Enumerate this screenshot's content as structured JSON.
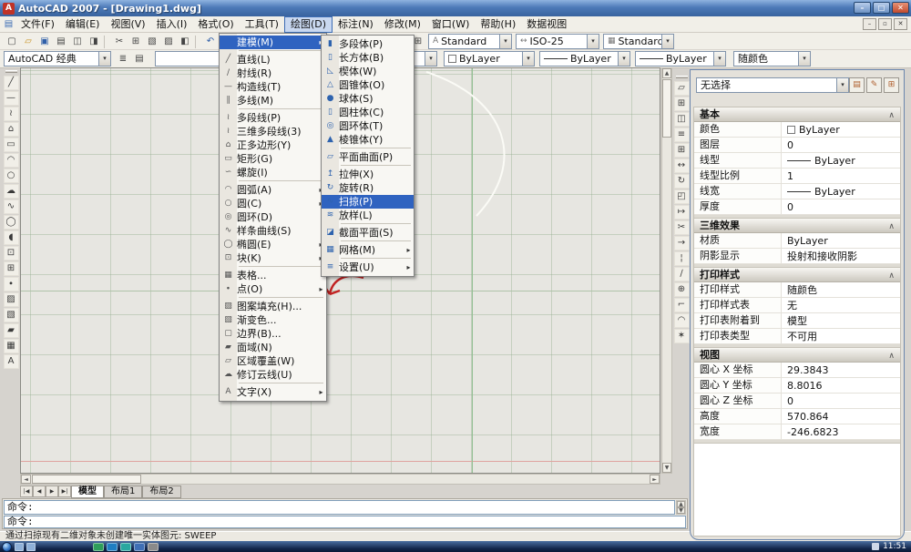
{
  "window": {
    "title": "AutoCAD 2007 - [Drawing1.dwg]",
    "buttons": [
      "minimize",
      "maximize",
      "close"
    ],
    "mdi_buttons": [
      "minimize",
      "restore",
      "close"
    ]
  },
  "menubar": {
    "items": [
      "文件(F)",
      "编辑(E)",
      "视图(V)",
      "插入(I)",
      "格式(O)",
      "工具(T)",
      "绘图(D)",
      "标注(N)",
      "修改(M)",
      "窗口(W)",
      "帮助(H)",
      "数据视图"
    ],
    "active": "绘图(D)"
  },
  "toolbar1": {
    "icons": [
      "new",
      "open",
      "save",
      "plot",
      "plot-preview",
      "publish",
      "cut",
      "copy",
      "paste",
      "match-properties",
      "block-editor",
      "undo",
      "redo",
      "pan",
      "zoom-realtime",
      "zoom-window",
      "zoom-previous",
      "properties",
      "designcenter",
      "tool-palettes",
      "sheetset",
      "markup",
      "calc",
      "help"
    ],
    "style_combo": "Standard",
    "dim_combo": "ISO-25",
    "table_combo": "Standard"
  },
  "toolbar2": {
    "workspace_combo": "AutoCAD 经典",
    "icons": [
      "layer-properties",
      "layer-states"
    ],
    "layer_combo": "",
    "color_combo": "ByLayer",
    "linetype_combo": "ByLayer",
    "lineweight_combo": "ByLayer",
    "plotstyle_combo": "随颜色"
  },
  "left_toolbar": {
    "icons": [
      "line",
      "xline",
      "pline",
      "polygon",
      "rectangle",
      "arc",
      "circle",
      "revcloud",
      "spline",
      "ellipse",
      "ellipse-arc",
      "insert-block",
      "make-block",
      "point",
      "hatch",
      "gradient",
      "region",
      "table",
      "mtext"
    ]
  },
  "modify_toolbar": {
    "icons": [
      "erase",
      "copy",
      "mirror",
      "offset",
      "array",
      "move",
      "rotate",
      "scale",
      "stretch",
      "trim",
      "extend",
      "break-at-point",
      "break",
      "join",
      "chamfer",
      "fillet",
      "explode"
    ]
  },
  "draw_menu": {
    "items": [
      {
        "label": "建模(M)",
        "icon": "",
        "submenu": true,
        "highlighted": true,
        "sep_after": true
      },
      {
        "label": "直线(L)",
        "icon": "line"
      },
      {
        "label": "射线(R)",
        "icon": "ray"
      },
      {
        "label": "构造线(T)",
        "icon": "xline"
      },
      {
        "label": "多线(M)",
        "icon": "mline",
        "sep_after": true
      },
      {
        "label": "多段线(P)",
        "icon": "pline"
      },
      {
        "label": "三维多段线(3)",
        "icon": "pline"
      },
      {
        "label": "正多边形(Y)",
        "icon": "polygon"
      },
      {
        "label": "矩形(G)",
        "icon": "rectangle"
      },
      {
        "label": "螺旋(I)",
        "icon": "helix",
        "sep_after": true
      },
      {
        "label": "圆弧(A)",
        "icon": "arc",
        "submenu": true
      },
      {
        "label": "圆(C)",
        "icon": "circle",
        "submenu": true
      },
      {
        "label": "圆环(D)",
        "icon": "donut"
      },
      {
        "label": "样条曲线(S)",
        "icon": "spline"
      },
      {
        "label": "椭圆(E)",
        "icon": "ellipse",
        "submenu": true
      },
      {
        "label": "块(K)",
        "icon": "insert-block",
        "submenu": true,
        "sep_after": true
      },
      {
        "label": "表格...",
        "icon": "table"
      },
      {
        "label": "点(O)",
        "icon": "point",
        "submenu": true,
        "sep_after": true
      },
      {
        "label": "图案填充(H)...",
        "icon": "hatch"
      },
      {
        "label": "渐变色...",
        "icon": "gradient"
      },
      {
        "label": "边界(B)...",
        "icon": "boundary"
      },
      {
        "label": "面域(N)",
        "icon": "region"
      },
      {
        "label": "区域覆盖(W)",
        "icon": "wipeout"
      },
      {
        "label": "修订云线(U)",
        "icon": "revcloud",
        "sep_after": true
      },
      {
        "label": "文字(X)",
        "icon": "text",
        "submenu": true
      }
    ]
  },
  "modeling_submenu": {
    "items": [
      {
        "label": "多段体(P)",
        "icon": "polysolid"
      },
      {
        "label": "长方体(B)",
        "icon": "box"
      },
      {
        "label": "楔体(W)",
        "icon": "wedge"
      },
      {
        "label": "圆锥体(O)",
        "icon": "cone"
      },
      {
        "label": "球体(S)",
        "icon": "sphere"
      },
      {
        "label": "圆柱体(C)",
        "icon": "cylinder"
      },
      {
        "label": "圆环体(T)",
        "icon": "torus"
      },
      {
        "label": "棱锥体(Y)",
        "icon": "pyramid",
        "sep_after": true
      },
      {
        "label": "平面曲面(P)",
        "icon": "planesurf",
        "sep_after": true
      },
      {
        "label": "拉伸(X)",
        "icon": "extrude"
      },
      {
        "label": "旋转(R)",
        "icon": "revolve"
      },
      {
        "label": "扫掠(P)",
        "icon": "sweep",
        "highlighted": true
      },
      {
        "label": "放样(L)",
        "icon": "loft",
        "sep_after": true
      },
      {
        "label": "截面平面(S)",
        "icon": "section",
        "sep_after": true
      },
      {
        "label": "网格(M)",
        "icon": "mesh",
        "submenu": true,
        "sep_after": true
      },
      {
        "label": "设置(U)",
        "icon": "setup",
        "submenu": true
      }
    ]
  },
  "palette": {
    "selection_combo": "无选择",
    "header_buttons": [
      "toggle-value",
      "quick-select",
      "select-objects"
    ],
    "sections": [
      {
        "title": "基本",
        "rows": [
          {
            "label": "颜色",
            "value": "ByLayer",
            "swatch": "color"
          },
          {
            "label": "图层",
            "value": "0"
          },
          {
            "label": "线型",
            "value": "ByLayer",
            "swatch": "line"
          },
          {
            "label": "线型比例",
            "value": "1"
          },
          {
            "label": "线宽",
            "value": "ByLayer",
            "swatch": "line"
          },
          {
            "label": "厚度",
            "value": "0"
          }
        ]
      },
      {
        "title": "三维效果",
        "rows": [
          {
            "label": "材质",
            "value": "ByLayer"
          },
          {
            "label": "阴影显示",
            "value": "投射和接收阴影"
          }
        ]
      },
      {
        "title": "打印样式",
        "rows": [
          {
            "label": "打印样式",
            "value": "随颜色"
          },
          {
            "label": "打印样式表",
            "value": "无"
          },
          {
            "label": "打印表附着到",
            "value": "模型"
          },
          {
            "label": "打印表类型",
            "value": "不可用"
          }
        ]
      },
      {
        "title": "视图",
        "rows": [
          {
            "label": "圆心 X 坐标",
            "value": "29.3843"
          },
          {
            "label": "圆心 Y 坐标",
            "value": "8.8016"
          },
          {
            "label": "圆心 Z 坐标",
            "value": "0"
          },
          {
            "label": "高度",
            "value": "570.864"
          },
          {
            "label": "宽度",
            "value": "-246.6823"
          }
        ]
      }
    ]
  },
  "layout_tabs": {
    "tabs": [
      "模型",
      "布局1",
      "布局2"
    ],
    "active": "模型"
  },
  "command": {
    "history_line": "命令:",
    "input_line": "命令:"
  },
  "status": {
    "message": "通过扫掠现有二维对象未创建唯一实体图元: SWEEP"
  },
  "taskbar": {
    "time": "11:51",
    "app_colors": [
      "#2e9e5b",
      "#1f7ec2",
      "#2aa8a0",
      "#3f6fb5",
      "#8a8a8a"
    ]
  },
  "colors": {
    "selection_highlight": "#2f63c0",
    "grid_line": "#91ac8c",
    "x_axis": "#dfa3a0",
    "y_axis": "#93c093"
  }
}
